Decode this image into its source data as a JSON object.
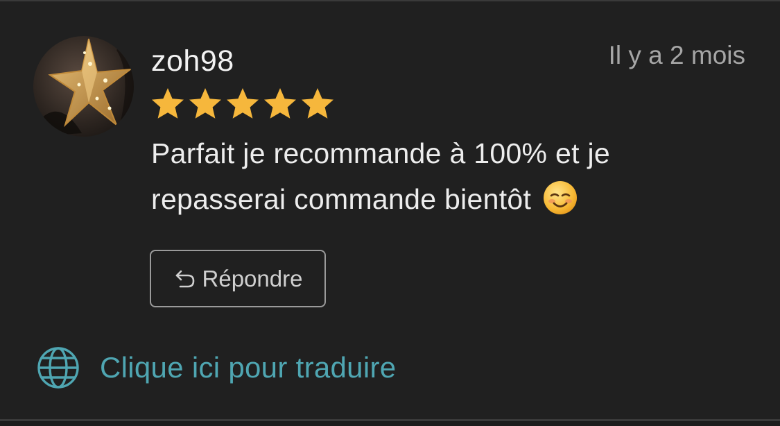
{
  "review": {
    "username": "zoh98",
    "time": "Il y a 2 mois",
    "rating": 5,
    "rating_max": 5,
    "text_line1": "Parfait je recommande à 100% et je",
    "text_line2": "repasserai commande bientôt",
    "emoji": "smiling-face-icon",
    "reply_label": "Répondre",
    "reply_icon": "reply-arrow-icon",
    "translate_label": "Clique ici pour traduire",
    "translate_icon": "globe-icon"
  },
  "colors": {
    "background": "#202020",
    "star": "#f6b73c",
    "link": "#4fa6b2",
    "text": "#ededed",
    "muted": "#a6a6a6"
  }
}
